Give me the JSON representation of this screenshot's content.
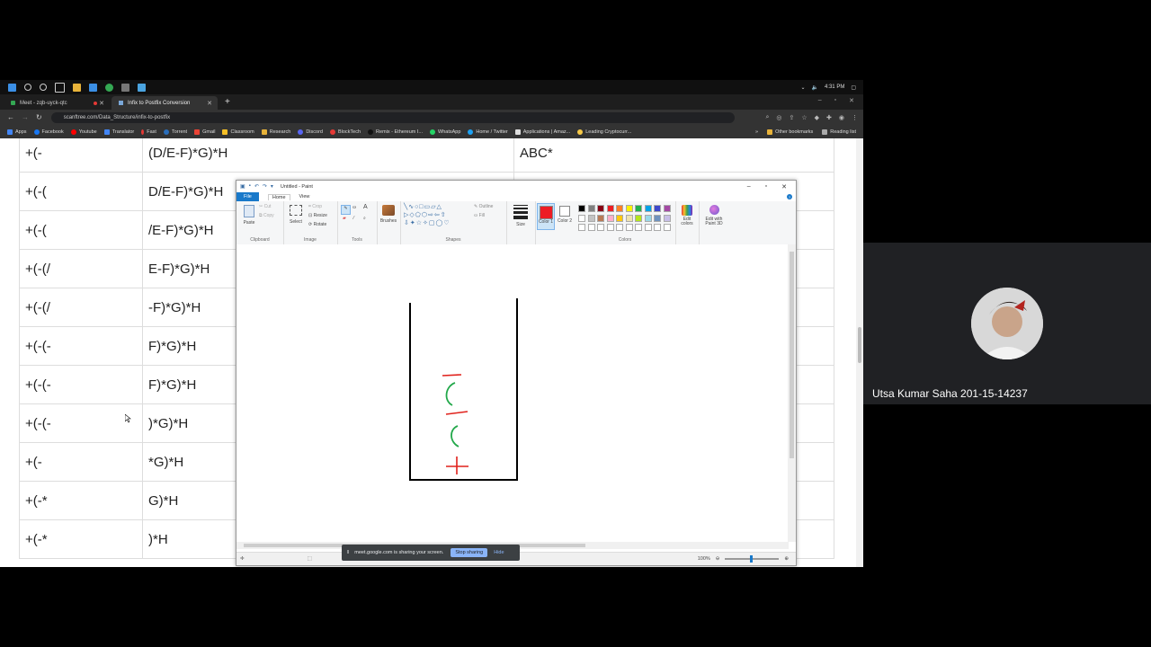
{
  "taskbar": {
    "time": "4:31 PM"
  },
  "browser": {
    "tabs": [
      {
        "label": "Meet - zqb-uyck-qtc",
        "active": false
      },
      {
        "label": "Infix to Postfix Conversion",
        "active": true
      }
    ],
    "new_tab": "+",
    "url": "scanftree.com/Data_Structure/infix-to-postfix",
    "bookmarks": [
      "Apps",
      "Facebook",
      "Youtube",
      "Translator",
      "Fast",
      "Torrent",
      "Gmail",
      "Classroom",
      "Research",
      "Discord",
      "BlockTech",
      "Remix - Ethereum I...",
      "WhatsApp",
      "Home / Twitter",
      "Applications | Amaz...",
      "Leading Cryptocurr..."
    ],
    "bookmarks_more": "»",
    "other_bookmarks": "Other bookmarks",
    "reading_list": "Reading list"
  },
  "table": {
    "rows": [
      [
        "+(-",
        "(D/E-F)*G)*H",
        "ABC*"
      ],
      [
        "+(-(",
        "D/E-F)*G)*H",
        ""
      ],
      [
        "+(-(",
        "/E-F)*G)*H",
        ""
      ],
      [
        "+(-(/",
        "E-F)*G)*H",
        ""
      ],
      [
        "+(-(/",
        "-F)*G)*H",
        ""
      ],
      [
        "+(-(-",
        "F)*G)*H",
        ""
      ],
      [
        "+(-(-",
        "F)*G)*H",
        ""
      ],
      [
        "+(-(-",
        ")*G)*H",
        ""
      ],
      [
        "+(-",
        "*G)*H",
        ""
      ],
      [
        "+(-*",
        "G)*H",
        ""
      ],
      [
        "+(-*",
        ")*H",
        ""
      ]
    ]
  },
  "paint": {
    "title": "Untitled - Paint",
    "menu": {
      "file": "File",
      "home": "Home",
      "view": "View"
    },
    "ribbon": {
      "paste": "Paste",
      "cut": "Cut",
      "copy": "Copy",
      "select": "Select",
      "crop": "Crop",
      "resize": "Resize",
      "rotate": "Rotate",
      "brushes": "Brushes",
      "outline": "Outline",
      "fill": "Fill",
      "size": "Size",
      "color1": "Color 1",
      "color2": "Color 2",
      "edit_colors": "Edit colors",
      "edit_paint3d": "Edit with Paint 3D",
      "groups": {
        "clipboard": "Clipboard",
        "image": "Image",
        "tools": "Tools",
        "shapes": "Shapes",
        "colors": "Colors"
      }
    },
    "palette": [
      "#000000",
      "#7f7f7f",
      "#880015",
      "#ed1c24",
      "#ff7f27",
      "#fff200",
      "#22b14c",
      "#00a2e8",
      "#3f48cc",
      "#a349a4",
      "#ffffff",
      "#c3c3c3",
      "#b97a57",
      "#ffaec9",
      "#ffc90e",
      "#efe4b0",
      "#b5e61d",
      "#99d9ea",
      "#7092be",
      "#c8bfe7"
    ],
    "color1": "#ed1c24",
    "zoom": "100%"
  },
  "share_banner": {
    "text": "meet.google.com is sharing your screen.",
    "stop": "Stop sharing",
    "hide": "Hide"
  },
  "participant": {
    "name": "Utsa Kumar Saha 201-15-14237"
  }
}
